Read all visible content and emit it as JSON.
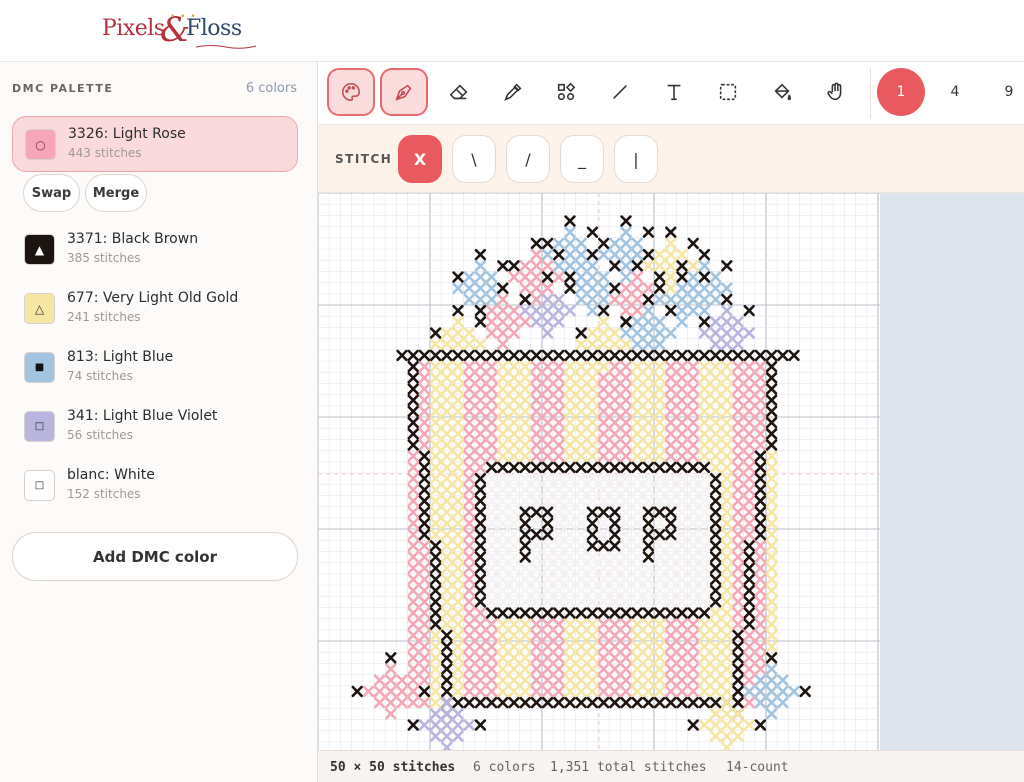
{
  "app": {
    "logo_left": "Pixels",
    "logo_amp": "&",
    "logo_right": "Floss"
  },
  "palette": {
    "title": "DMC PALETTE",
    "count": "6 colors",
    "colors": [
      {
        "label": "3326: Light Rose",
        "stitches": "443 stitches",
        "hex": "#f5a7b8",
        "symbol": "○"
      },
      {
        "label": "3371: Black Brown",
        "stitches": "385 stitches",
        "hex": "#1c1410",
        "symbol": "▲"
      },
      {
        "label": "677: Very Light Old Gold",
        "stitches": "241 stitches",
        "hex": "#f5e6a3",
        "symbol": "△"
      },
      {
        "label": "813: Light Blue",
        "stitches": "74 stitches",
        "hex": "#a3c4e0",
        "symbol": "■"
      },
      {
        "label": "341: Light Blue Violet",
        "stitches": "56 stitches",
        "hex": "#b9b5df",
        "symbol": "□"
      },
      {
        "label": "blanc: White",
        "stitches": "152 stitches",
        "hex": "#ffffff",
        "symbol": "□"
      }
    ],
    "swap_label": "Swap",
    "merge_label": "Merge",
    "add_label": "Add DMC color"
  },
  "toolbar": {
    "tools": [
      "palette-icon",
      "pen-icon",
      "eraser-icon",
      "eyedropper-icon",
      "shapes-icon",
      "line-icon",
      "text-icon",
      "select-icon",
      "fill-icon",
      "hand-icon"
    ],
    "zoom_levels": [
      "1",
      "4",
      "9"
    ],
    "active_zoom": "1"
  },
  "stitch": {
    "label": "STITCH",
    "types": [
      "X",
      "\\",
      "/",
      "_",
      "|"
    ],
    "active": "X"
  },
  "status": {
    "dims": "50 × 50 stitches",
    "colors": "6 colors",
    "total": "1,351 total stitches",
    "count": "14-count"
  },
  "colors": {
    "accent": "#e85a5f",
    "selected_bg": "#fadadd",
    "pink": "#f5a7b8",
    "yellow": "#f5e6a3",
    "blue": "#a3c4e0",
    "violet": "#b9b5df",
    "black": "#1c1410"
  }
}
